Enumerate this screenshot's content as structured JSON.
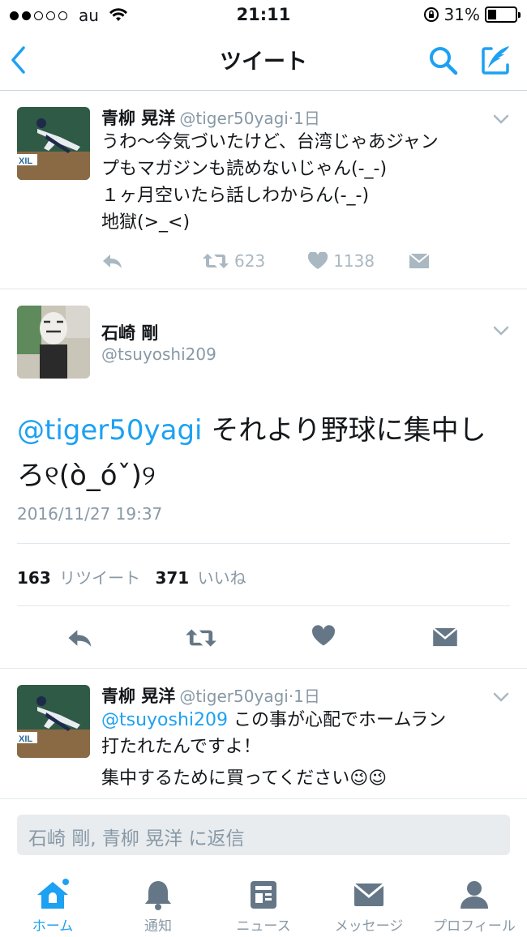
{
  "status_bar": {
    "carrier": "au",
    "time": "21:11",
    "battery": "31%",
    "battery_level": 0.31
  },
  "nav": {
    "title": "ツイート",
    "back_icon": "chevron-left-icon",
    "search_icon": "search-icon",
    "compose_icon": "compose-icon"
  },
  "tweets": [
    {
      "name": "青柳 晃洋",
      "handle": "@tiger50yagi",
      "time": "·1日",
      "lines": [
        "うわ〜今気づいたけど、台湾じゃあジャン",
        "プもマガジンも読めないじゃん(-_-)",
        "１ヶ月空いたら話しわからん(-_-)",
        "地獄(>_<)"
      ],
      "retweets": "623",
      "likes": "1138"
    },
    {
      "name": "石崎 剛",
      "handle": "@tsuyoshi209",
      "mention": "@tiger50yagi",
      "text_line1": " それより野球に集中し",
      "text_line2": "ろ୧(ò_óˇ)୨",
      "timestamp": "2016/11/27 19:37",
      "retweet_count": "163",
      "retweet_label": "リツイート",
      "like_count": "371",
      "like_label": "いいね"
    },
    {
      "name": "青柳 晃洋",
      "handle": "@tiger50yagi",
      "time": "·1日",
      "mention": "@tsuyoshi209",
      "line1": " この事が心配でホームラン",
      "line2": "打たれたんですよ！",
      "line3": "集中するために買ってください😉😉"
    }
  ],
  "reply": {
    "placeholder": "石崎 剛, 青柳 晃洋 に返信"
  },
  "tabs": [
    {
      "label": "ホーム",
      "icon": "home-icon",
      "active": true
    },
    {
      "label": "通知",
      "icon": "bell-icon"
    },
    {
      "label": "ニュース",
      "icon": "news-icon"
    },
    {
      "label": "メッセージ",
      "icon": "envelope-icon"
    },
    {
      "label": "プロフィール",
      "icon": "person-icon"
    }
  ],
  "colors": {
    "accent": "#1da1f2",
    "muted": "#8899a6",
    "icon_gray": "#657786",
    "divider": "#e1e8ed"
  }
}
